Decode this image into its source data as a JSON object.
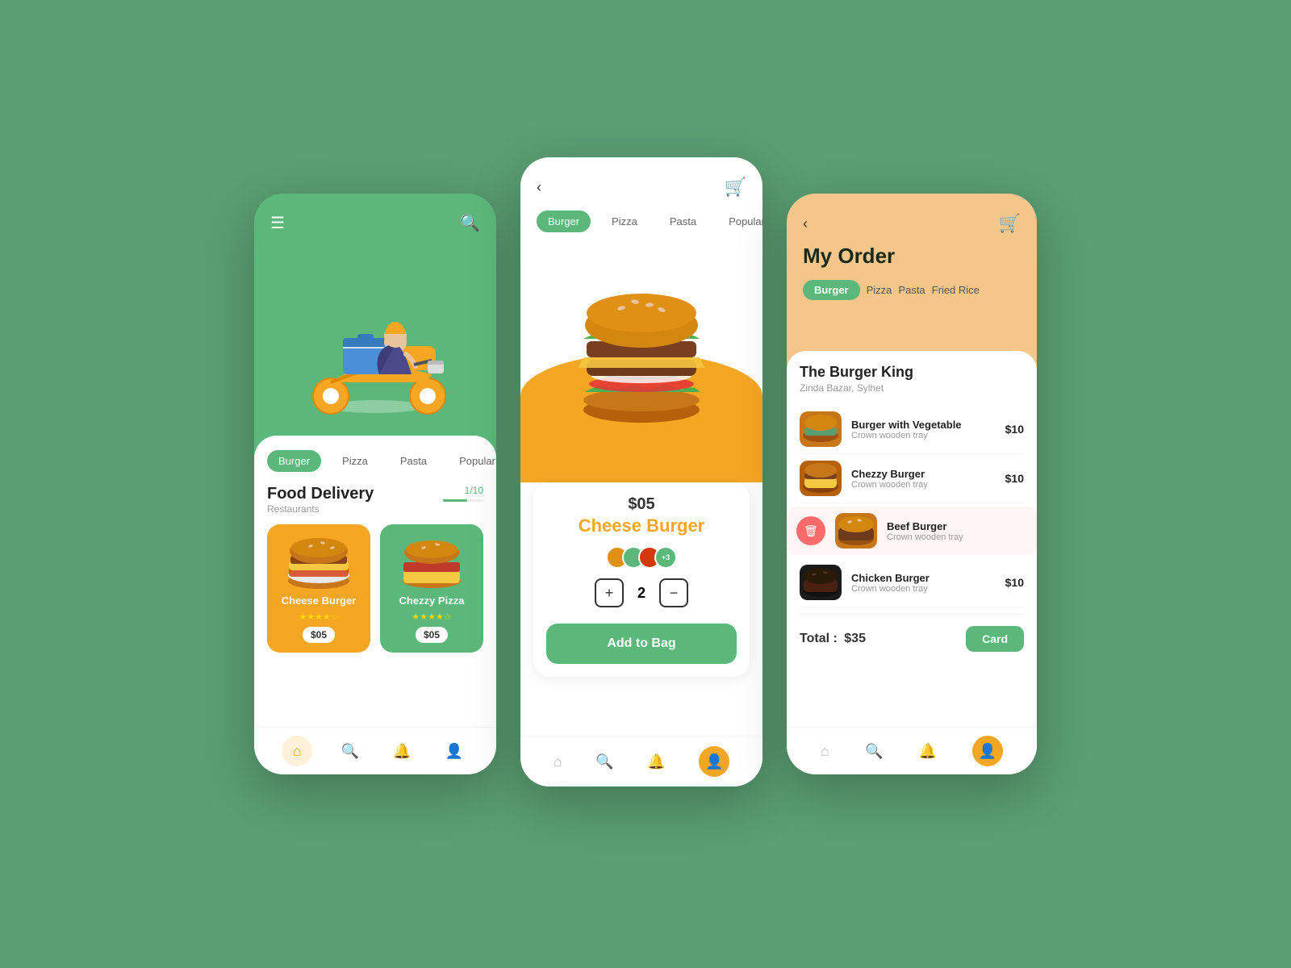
{
  "background_color": "#5a9e72",
  "phone1": {
    "header": {
      "menu_icon": "☰",
      "search_icon": "🔍"
    },
    "tabs": [
      {
        "label": "Burger",
        "active": true
      },
      {
        "label": "Pizza",
        "active": false
      },
      {
        "label": "Pasta",
        "active": false
      },
      {
        "label": "Popular",
        "active": false
      }
    ],
    "section": {
      "title": "Food Delivery",
      "subtitle": "Restaurants",
      "pagination": "1/10"
    },
    "foods": [
      {
        "name": "Cheese Burger",
        "stars": "★★★★☆",
        "price": "$05",
        "bg_color": "#f5a623"
      },
      {
        "name": "Chezzy Pizza",
        "stars": "★★★★☆",
        "price": "$05",
        "bg_color": "#5cb87a"
      }
    ],
    "bottom_nav": [
      "home",
      "search",
      "bell",
      "user"
    ]
  },
  "phone2": {
    "tabs": [
      {
        "label": "Burger",
        "active": true
      },
      {
        "label": "Pizza",
        "active": false
      },
      {
        "label": "Pasta",
        "active": false
      },
      {
        "label": "Popular",
        "active": false
      }
    ],
    "product": {
      "price": "$05",
      "name": "Cheese Burger",
      "quantity": 2,
      "add_to_bag_label": "Add to Bag"
    },
    "bottom_nav": [
      "home",
      "search",
      "bell",
      "user"
    ]
  },
  "phone3": {
    "title": "My Order",
    "tabs": [
      {
        "label": "Burger",
        "active": true
      },
      {
        "label": "Pizza",
        "active": false
      },
      {
        "label": "Pasta",
        "active": false
      },
      {
        "label": "Fried Rice",
        "active": false
      }
    ],
    "restaurant": {
      "name": "The Burger King",
      "location": "Zinda Bazar, Sylhet"
    },
    "items": [
      {
        "name": "Burger with Vegetable",
        "sub": "Crown wooden tray",
        "price": "$10",
        "highlighted": false
      },
      {
        "name": "Chezzy Burger",
        "sub": "Crown wooden tray",
        "price": "$10",
        "highlighted": false
      },
      {
        "name": "Beef Burger",
        "sub": "Crown wooden tray",
        "price": null,
        "highlighted": true
      },
      {
        "name": "Chicken Burger",
        "sub": "Crown wooden tray",
        "price": "$10",
        "highlighted": false
      }
    ],
    "total": {
      "label": "Total :",
      "amount": "$35",
      "button": "Card"
    },
    "bottom_nav": [
      "home",
      "search",
      "bell",
      "user"
    ]
  }
}
